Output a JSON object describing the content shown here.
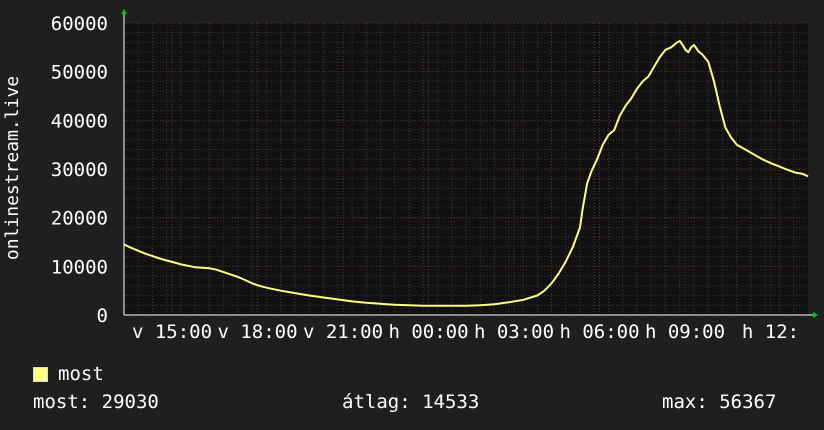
{
  "chart_data": {
    "type": "line",
    "ylabel": "onlinestream.live",
    "ylim": [
      0,
      60000
    ],
    "yticks": [
      "0",
      "10000",
      "20000",
      "30000",
      "40000",
      "50000",
      "60000"
    ],
    "xticks": [
      "v 15:00",
      "v 18:00",
      "v 21:00",
      "h 00:00",
      "h 03:00",
      "h 06:00",
      "h 09:00",
      "h 12:"
    ],
    "grid": true,
    "series": [
      {
        "name": "most",
        "color": "#ffff80",
        "points": [
          [
            0,
            14500
          ],
          [
            5,
            13800
          ],
          [
            10,
            13200
          ],
          [
            15,
            12600
          ],
          [
            20,
            12100
          ],
          [
            25,
            11600
          ],
          [
            30,
            11200
          ],
          [
            35,
            10800
          ],
          [
            40,
            10400
          ],
          [
            45,
            10100
          ],
          [
            50,
            9800
          ],
          [
            55,
            9700
          ],
          [
            60,
            9600
          ],
          [
            65,
            9300
          ],
          [
            70,
            8800
          ],
          [
            75,
            8300
          ],
          [
            80,
            7800
          ],
          [
            85,
            7200
          ],
          [
            90,
            6500
          ],
          [
            95,
            6000
          ],
          [
            100,
            5600
          ],
          [
            110,
            5000
          ],
          [
            120,
            4500
          ],
          [
            130,
            4000
          ],
          [
            140,
            3600
          ],
          [
            150,
            3200
          ],
          [
            160,
            2800
          ],
          [
            170,
            2500
          ],
          [
            180,
            2300
          ],
          [
            190,
            2100
          ],
          [
            200,
            2000
          ],
          [
            210,
            1900
          ],
          [
            220,
            1900
          ],
          [
            230,
            1900
          ],
          [
            240,
            1900
          ],
          [
            250,
            2000
          ],
          [
            260,
            2200
          ],
          [
            270,
            2600
          ],
          [
            280,
            3100
          ],
          [
            290,
            4000
          ],
          [
            295,
            5000
          ],
          [
            300,
            6500
          ],
          [
            305,
            8500
          ],
          [
            310,
            11000
          ],
          [
            315,
            14000
          ],
          [
            320,
            18000
          ],
          [
            322,
            22000
          ],
          [
            325,
            27000
          ],
          [
            328,
            29500
          ],
          [
            332,
            32000
          ],
          [
            336,
            35000
          ],
          [
            340,
            37000
          ],
          [
            344,
            38000
          ],
          [
            348,
            41000
          ],
          [
            352,
            43000
          ],
          [
            356,
            44500
          ],
          [
            360,
            46500
          ],
          [
            364,
            48000
          ],
          [
            368,
            49000
          ],
          [
            372,
            51000
          ],
          [
            376,
            53000
          ],
          [
            380,
            54500
          ],
          [
            384,
            55000
          ],
          [
            388,
            56000
          ],
          [
            390,
            56300
          ],
          [
            392,
            55500
          ],
          [
            394,
            54500
          ],
          [
            396,
            54000
          ],
          [
            398,
            55000
          ],
          [
            400,
            55500
          ],
          [
            403,
            54200
          ],
          [
            406,
            53500
          ],
          [
            410,
            52000
          ],
          [
            414,
            48000
          ],
          [
            418,
            43000
          ],
          [
            422,
            38500
          ],
          [
            426,
            36500
          ],
          [
            430,
            35000
          ],
          [
            436,
            34000
          ],
          [
            442,
            33000
          ],
          [
            448,
            32000
          ],
          [
            454,
            31200
          ],
          [
            460,
            30500
          ],
          [
            466,
            29800
          ],
          [
            472,
            29200
          ],
          [
            476,
            29030
          ],
          [
            480,
            28500
          ]
        ]
      }
    ]
  },
  "legend": {
    "label": "most"
  },
  "stats": {
    "current": "most: 29030",
    "average": "átlag: 14533",
    "max": "max: 56367"
  },
  "colors": {
    "background": "#1f1f1f",
    "plot_background": "#111111",
    "line": "#ffff80",
    "grid_minor": "#3a3a3a",
    "grid_major": "#6a3030",
    "arrow": "#00cc00"
  }
}
